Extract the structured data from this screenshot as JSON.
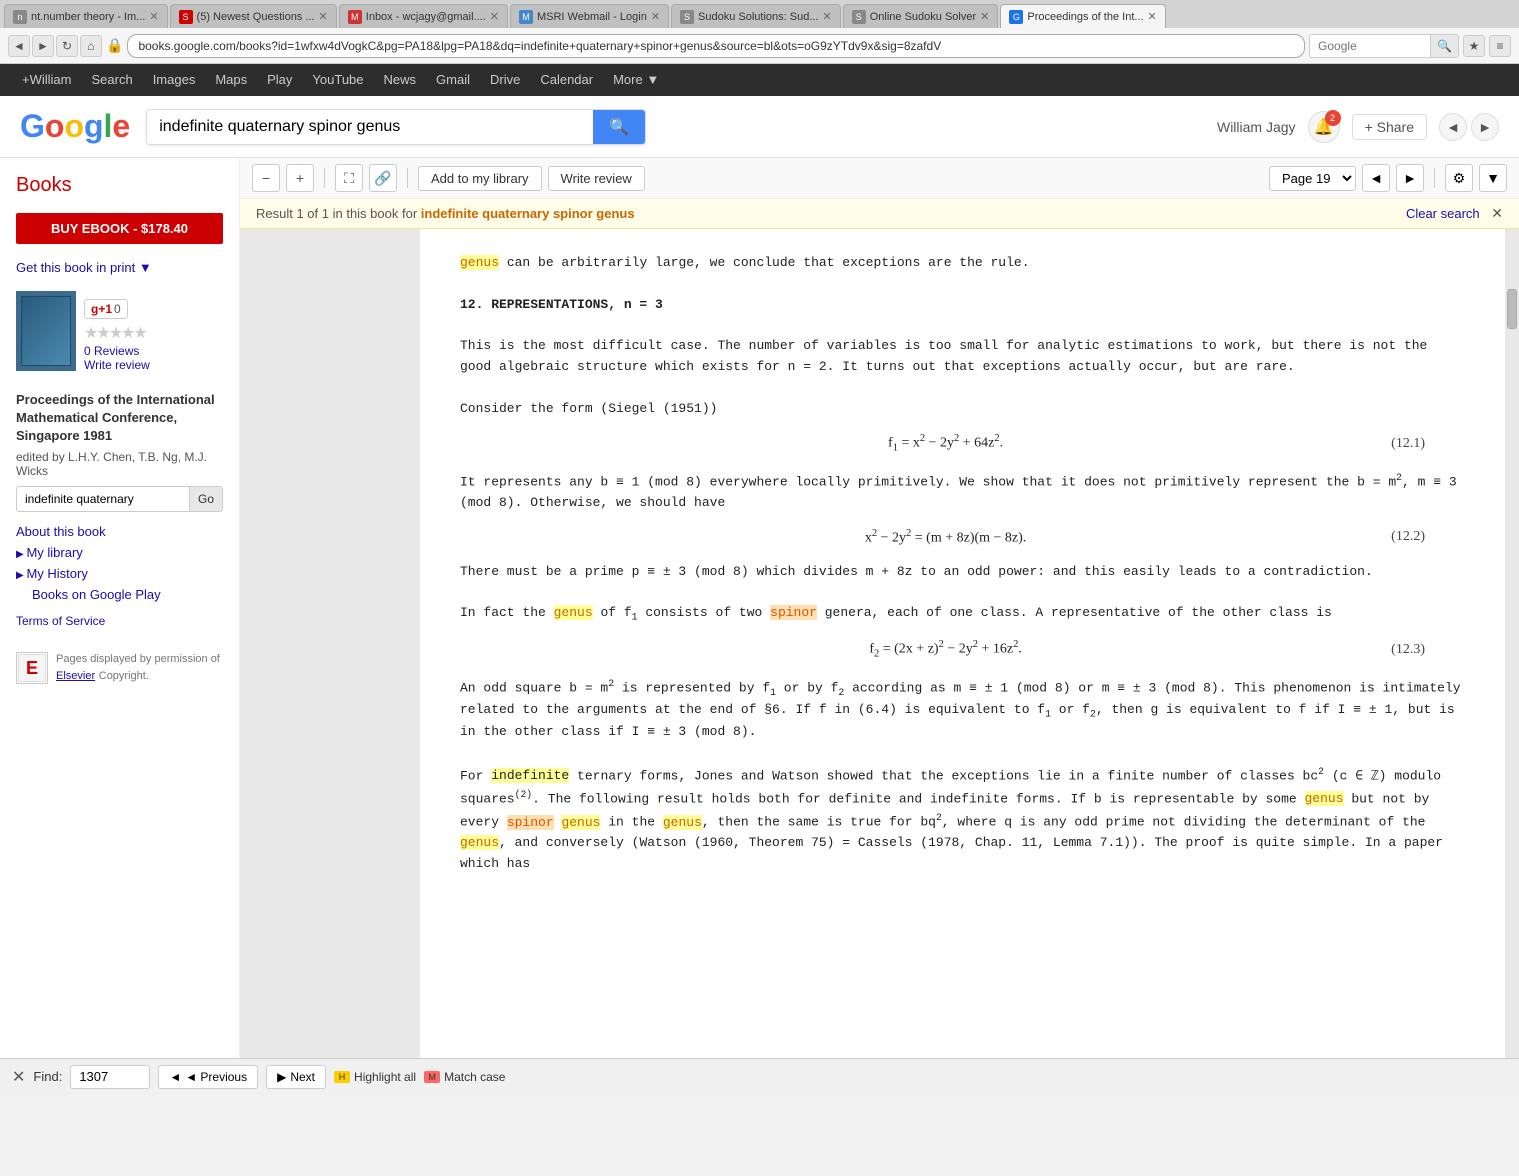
{
  "browser": {
    "tabs": [
      {
        "id": "tab1",
        "label": "nt.number theory - Im...",
        "favicon_color": "#888",
        "active": false
      },
      {
        "id": "tab2",
        "label": "(5) Newest Questions ...",
        "favicon_color": "#c00",
        "active": false
      },
      {
        "id": "tab3",
        "label": "Inbox - wcjagy@gmail....",
        "favicon_color": "#c33",
        "active": false
      },
      {
        "id": "tab4",
        "label": "MSRI Webmail - Login",
        "favicon_color": "#4488cc",
        "active": false
      },
      {
        "id": "tab5",
        "label": "Sudoku Solutions: Sud...",
        "favicon_color": "#888",
        "active": false
      },
      {
        "id": "tab6",
        "label": "Online Sudoku Solver",
        "favicon_color": "#888",
        "active": false
      },
      {
        "id": "tab7",
        "label": "Proceedings of the Int...",
        "favicon_color": "#1a73e8",
        "active": true
      }
    ],
    "url": "books.google.com/books?id=1wfxw4dVogkC&pg=PA18&lpg=PA18&dq=indefinite+quaternary+spinor+genus&source=bl&ots=oG9zYTdv9x&sig=8zafdV",
    "search_placeholder": "Google"
  },
  "google_nav": {
    "user": "+William",
    "links": [
      "Search",
      "Images",
      "Maps",
      "Play",
      "YouTube",
      "News",
      "Gmail",
      "Drive",
      "Calendar",
      "More"
    ]
  },
  "search_bar": {
    "query": "indefinite quaternary spinor genus",
    "user_name": "William Jagy",
    "notification_count": "2",
    "share_label": "+ Share"
  },
  "books_header": {
    "label": "Books"
  },
  "toolbar": {
    "add_library": "Add to my library",
    "write_review": "Write review",
    "page_label": "Page 19",
    "gear": "⚙"
  },
  "search_result": {
    "result_text": "Result 1 of 1 in this book for ",
    "search_term": "indefinite quaternary spinor genus",
    "clear_search": "Clear search"
  },
  "sidebar": {
    "buy_btn": "BUY EBOOK - $178.40",
    "get_print": "Get this book in print ▼",
    "reviews_count": "0 Reviews",
    "write_review": "Write review",
    "book_title": "Proceedings of the International Mathematical Conference, Singapore 1981",
    "edited_by": "edited by L.H.Y. Chen, T.B. Ng, M.J. Wicks",
    "page_search_value": "indefinite quaternary",
    "go_btn": "Go",
    "about_link": "About this book",
    "my_library": "My library",
    "my_history": "My History",
    "books_play": "Books on Google Play",
    "terms": "Terms of Service",
    "permission_text": "Pages displayed by permission of",
    "elsevier": "Elsevier",
    "copyright": "Copyright."
  },
  "book_content": {
    "para1": "genus can be arbitrarily large, we conclude that exceptions are the rule.",
    "heading": "12.  REPRESENTATIONS, n = 3",
    "para2": "This is the most difficult case.  The number of variables is too small for analytic estimations to work, but there is not the good algebraic structure which exists for  n = 2.  It turns out that exceptions actually occur, but are rare.",
    "para3": "Consider the form (Siegel (1951))",
    "formula1_left": "f₁ = x² − 2y² + 64z².",
    "formula1_num": "(12.1)",
    "para4": "It represents any  b ≡ 1 (mod 8)  everywhere locally primitively. We show that it does not primitively represent the  b = m², m ≡ 3 (mod 8).  Otherwise, we should have",
    "formula2_left": "x² − 2y² = (m + 8z)(m − 8z).",
    "formula2_num": "(12.2)",
    "para5": "There must be a prime  p ≡ ± 3 (mod 8)  which divides  m + 8z  to an odd power: and this easily leads to a contradiction.",
    "para6_start": "In fact the ",
    "para6_genus": "genus",
    "para6_mid": " of  f₁  consists of two ",
    "para6_spinor": "spinor",
    "para6_end": " genera, each of one class.  A representative of the other class is",
    "formula3_left": "f₂ = (2x + z)² − 2y² + 16z².",
    "formula3_num": "(12.3)",
    "para7": "An odd square  b = m² is represented by  f₁  or by  f₂  according as  m ≡ ± 1 (mod 8) or  m ≡ ± 3 (mod 8).  This phenomenon is intimately related to the arguments at the end of §6.  If  f  in (6.4) is equivalent to  f₁  or  f₂,  then  g  is equivalent to  f  if I ≡ ± 1,  but is in the other class if  I ≡ ± 3 (mod 8).",
    "para8_start": "For ",
    "para8_indef": "indefinite",
    "para8_end": " ternary forms, Jones and Watson showed that the exceptions lie in a finite number of classes  bc² (c ∈ ℤ)  modulo squares⁽²⁾.  The following result holds both for definite and indefinite forms.  If  b  is representable by some ",
    "para8_genus2": "genus",
    "para8_cont": " but not by every ",
    "para8_spinor2": "spinor",
    "para8_genus3": "genus",
    "para8_rest": " in the ",
    "para8_genus4": "genus",
    "para8_final": ",  then the same is true for  bq²,  where  q  is any odd prime not dividing the determinant of the ",
    "para8_genus5": "genus",
    "para8_last": ",  and conversely (Watson (1960, Theorem 75) = Cassels (1978, Chap. 11, Lemma 7.1)).  The proof is quite simple.  In a paper which has"
  },
  "find_bar": {
    "close": "✕",
    "label": "Find:",
    "value": "1307",
    "prev_btn": "◄ Previous",
    "next_btn": "▶ Next",
    "highlight_all": "Highlight all",
    "match_case": "Match case"
  }
}
